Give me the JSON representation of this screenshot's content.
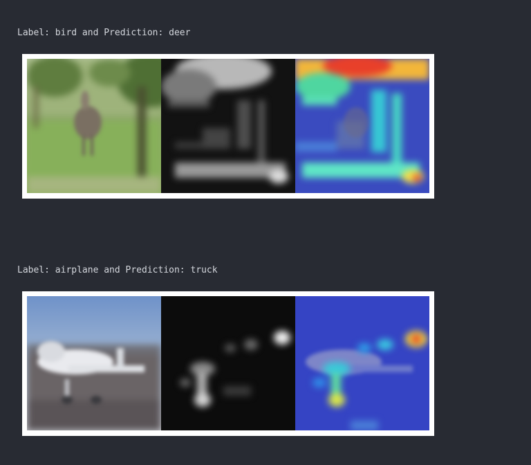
{
  "outputs": [
    {
      "text": "Label: bird and Prediction: deer",
      "label": "bird",
      "prediction": "deer"
    },
    {
      "text": "Label: airplane and Prediction: truck",
      "label": "airplane",
      "prediction": "truck"
    }
  ],
  "colors": {
    "background": "#282b33",
    "text": "#d3d6dc",
    "figure_border": "#ffffff"
  }
}
